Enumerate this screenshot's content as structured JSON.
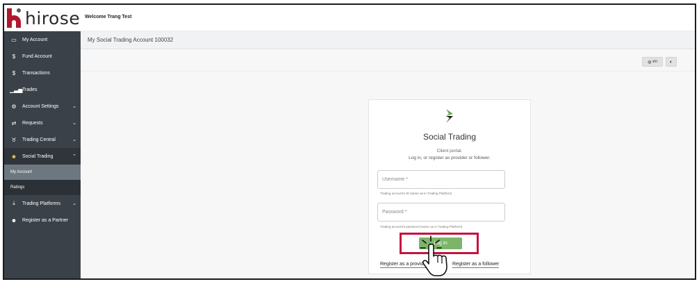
{
  "brand": {
    "logo_text": "hirose"
  },
  "header": {
    "welcome": "Welcome Trang Test"
  },
  "page": {
    "title": "My Social Trading Account 100032"
  },
  "toolbar": {
    "language": "en"
  },
  "sidebar": {
    "items": [
      {
        "label": "My Account",
        "icon": "monitor-icon"
      },
      {
        "label": "Fund Account",
        "icon": "dollar-icon"
      },
      {
        "label": "Transactions",
        "icon": "dollar-icon"
      },
      {
        "label": "Trades",
        "icon": "bar-chart-icon"
      },
      {
        "label": "Account Settings",
        "icon": "settings-icon"
      },
      {
        "label": "Requests",
        "icon": "swap-arrows-icon"
      },
      {
        "label": "Trading Central",
        "icon": "bull-icon"
      },
      {
        "label": "Social Trading",
        "icon": "users-icon"
      },
      {
        "label": "Trading Platforms",
        "icon": "download-icon"
      },
      {
        "label": "Register as a Partner",
        "icon": "users-icon"
      }
    ],
    "social_sub": [
      {
        "label": "My Account"
      },
      {
        "label": "Ratings"
      }
    ]
  },
  "login": {
    "title": "Social Trading",
    "subtitle": "Client portal.",
    "description": "Log in, or register as provider or follower.",
    "username_placeholder": "Username *",
    "username_hint": "Trading account's ID (same as in Trading Platform)",
    "password_placeholder": "Password *",
    "password_hint": "Trading account's password (same as in Trading Platform)",
    "login_label": "Log In",
    "register_provider": "Register as a provider",
    "register_follower": "Register as a follower"
  },
  "colors": {
    "sidebar_bg": "#3a4148",
    "brand_red": "#b0182e",
    "login_green": "#7cb56a",
    "highlight_red": "#c4133e"
  }
}
